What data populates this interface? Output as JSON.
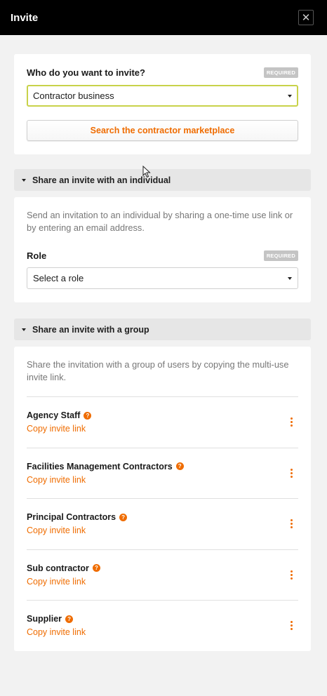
{
  "header": {
    "title": "Invite",
    "close_icon": "close-icon"
  },
  "invite_type": {
    "label": "Who do you want to invite?",
    "required_badge": "REQUIRED",
    "selected": "Contractor business",
    "search_button": "Search the contractor marketplace"
  },
  "individual": {
    "section_title": "Share an invite with an individual",
    "description": "Send an invitation to an individual by sharing a one-time use link or by entering an email address.",
    "role_label": "Role",
    "required_badge": "REQUIRED",
    "role_placeholder": "Select a role"
  },
  "group": {
    "section_title": "Share an invite with a group",
    "description": "Share the invitation with a group of users by copying the multi-use invite link.",
    "items": [
      {
        "name": "Agency Staff",
        "link": "Copy invite link"
      },
      {
        "name": "Facilities Management Contractors",
        "link": "Copy invite link"
      },
      {
        "name": "Principal Contractors",
        "link": "Copy invite link"
      },
      {
        "name": "Sub contractor",
        "link": "Copy invite link"
      },
      {
        "name": "Supplier",
        "link": "Copy invite link"
      }
    ],
    "help_glyph": "?"
  },
  "colors": {
    "accent": "#ef6c00",
    "header_bg": "#000000",
    "focus_border": "#c8d24a"
  }
}
